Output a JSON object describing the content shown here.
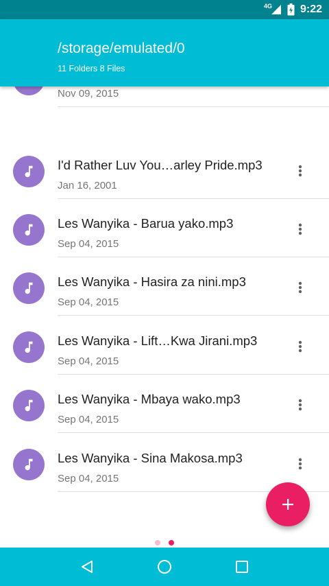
{
  "status_bar": {
    "network": "4G",
    "time": "9:22",
    "icons": [
      "signal-icon",
      "battery-icon"
    ]
  },
  "toolbar": {
    "title": "/storage/emulated/0",
    "subtitle": "11 Folders 8 Files"
  },
  "files": [
    {
      "name": "",
      "date": "Nov 09, 2015",
      "icon": "music-note-icon"
    },
    {
      "name": "I'd Rather Luv You…arley Pride.mp3",
      "date": "Jan 16, 2001",
      "icon": "music-note-icon"
    },
    {
      "name": "Les Wanyika - Barua yako.mp3",
      "date": "Sep 04, 2015",
      "icon": "music-note-icon"
    },
    {
      "name": "Les Wanyika - Hasira za nini.mp3",
      "date": "Sep 04, 2015",
      "icon": "music-note-icon"
    },
    {
      "name": "Les Wanyika - Lift…Kwa Jirani.mp3",
      "date": "Sep 04, 2015",
      "icon": "music-note-icon"
    },
    {
      "name": "Les Wanyika - Mbaya wako.mp3",
      "date": "Sep 04, 2015",
      "icon": "music-note-icon"
    },
    {
      "name": "Les Wanyika - Sina Makosa.mp3",
      "date": "Sep 04, 2015",
      "icon": "music-note-icon"
    }
  ],
  "fab": {
    "icon": "plus-icon"
  },
  "pager": {
    "pages": 2,
    "active_page": 2
  },
  "nav_bar": {
    "icons": [
      "back-icon",
      "home-icon",
      "recents-icon"
    ]
  },
  "colors": {
    "status_bar": "#00838f",
    "toolbar": "#00bcd4",
    "avatar": "#9575cd",
    "fab": "#e91e63",
    "dot_active": "#e91e63",
    "dot_inactive": "#f8bbd0"
  }
}
